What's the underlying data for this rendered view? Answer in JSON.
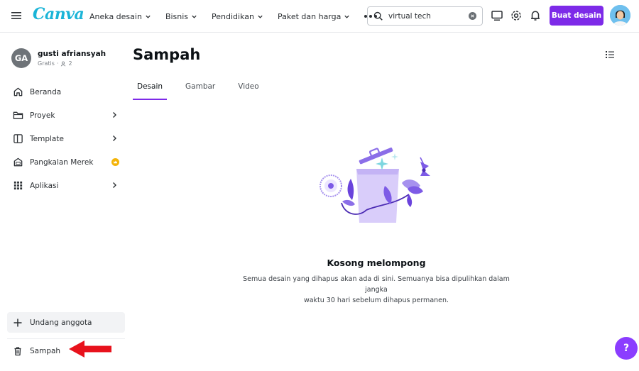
{
  "header": {
    "logo": "Canva",
    "nav": [
      "Aneka desain",
      "Bisnis",
      "Pendidikan",
      "Paket dan harga"
    ],
    "search_value": "virtual tech",
    "create_label": "Buat desain"
  },
  "sidebar": {
    "initials": "GA",
    "user_name": "gusti afriansyah",
    "plan": "Gratis",
    "members": "2",
    "items": [
      {
        "label": "Beranda",
        "icon": "home-icon"
      },
      {
        "label": "Proyek",
        "icon": "folder-icon"
      },
      {
        "label": "Template",
        "icon": "template-icon"
      },
      {
        "label": "Pangkalan Merek",
        "icon": "brand-icon"
      },
      {
        "label": "Aplikasi",
        "icon": "apps-icon"
      }
    ],
    "invite_label": "Undang anggota",
    "trash_label": "Sampah"
  },
  "main": {
    "title": "Sampah",
    "tabs": [
      "Desain",
      "Gambar",
      "Video"
    ],
    "empty_title": "Kosong melompong",
    "empty_desc_line1": "Semua desain yang dihapus akan ada di sini. Semuanya bisa dipulihkan dalam jangka",
    "empty_desc_line2": "waktu 30 hari sebelum dihapus permanen."
  },
  "help_label": "?",
  "colors": {
    "accent": "#7d2ae8",
    "logo": "#1ab4d7",
    "annotation_arrow": "#e8121c"
  }
}
